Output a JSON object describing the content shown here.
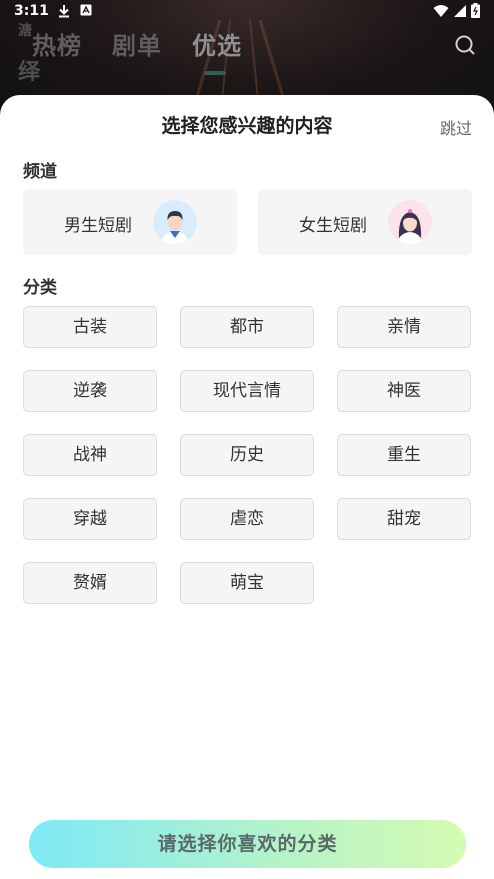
{
  "status": {
    "time": "3:11"
  },
  "bg": {
    "tabs": [
      {
        "label": "热榜"
      },
      {
        "label": "剧单"
      },
      {
        "label": "优选"
      }
    ],
    "stub_top": "溏",
    "stub_bottom": "绎"
  },
  "dialog": {
    "title": "选择您感兴趣的内容",
    "skip": "跳过",
    "channel_section": "频道",
    "channels": [
      {
        "label": "男生短剧",
        "icon": "male-avatar-icon"
      },
      {
        "label": "女生短剧",
        "icon": "female-avatar-icon"
      }
    ],
    "category_section": "分类",
    "categories": [
      "古装",
      "都市",
      "亲情",
      "逆袭",
      "现代言情",
      "神医",
      "战神",
      "历史",
      "重生",
      "穿越",
      "虐恋",
      "甜宠",
      "赘婿",
      "萌宝"
    ],
    "cta": "请选择你喜欢的分类"
  },
  "colors": {
    "accent_gradient_start": "#7ee9f7",
    "accent_gradient_end": "#d4fbb0",
    "tab_underline": "#2f5f58"
  }
}
